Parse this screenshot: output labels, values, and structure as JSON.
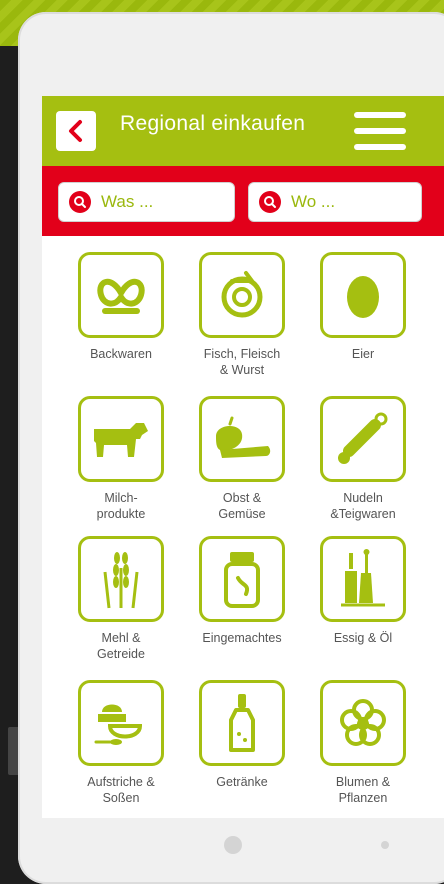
{
  "header": {
    "title": "Regional einkaufen"
  },
  "search": {
    "what_placeholder": "Was ...",
    "where_placeholder": "Wo ..."
  },
  "categories": [
    {
      "label": "Backwaren",
      "icon": "pretzel-icon"
    },
    {
      "label": "Fisch, Fleisch\n& Wurst",
      "icon": "sausage-icon"
    },
    {
      "label": "Eier",
      "icon": "egg-icon"
    },
    {
      "label": "Milch-\nprodukte",
      "icon": "cow-icon"
    },
    {
      "label": "Obst &\nGemüse",
      "icon": "fruit-vegetable-icon"
    },
    {
      "label": "Nudeln\n&Teigwaren",
      "icon": "rolling-pin-icon"
    },
    {
      "label": "Mehl &\nGetreide",
      "icon": "wheat-icon"
    },
    {
      "label": "Eingemachtes",
      "icon": "jar-icon"
    },
    {
      "label": "Essig & Öl",
      "icon": "bottles-icon"
    },
    {
      "label": "Aufstriche &\nSoßen",
      "icon": "spread-bowl-icon"
    },
    {
      "label": "Getränke",
      "icon": "bottle-icon"
    },
    {
      "label": "Blumen &\nPflanzen",
      "icon": "flower-icon"
    }
  ],
  "colors": {
    "brand_green": "#a5bf11",
    "brand_red": "#e2001a"
  }
}
